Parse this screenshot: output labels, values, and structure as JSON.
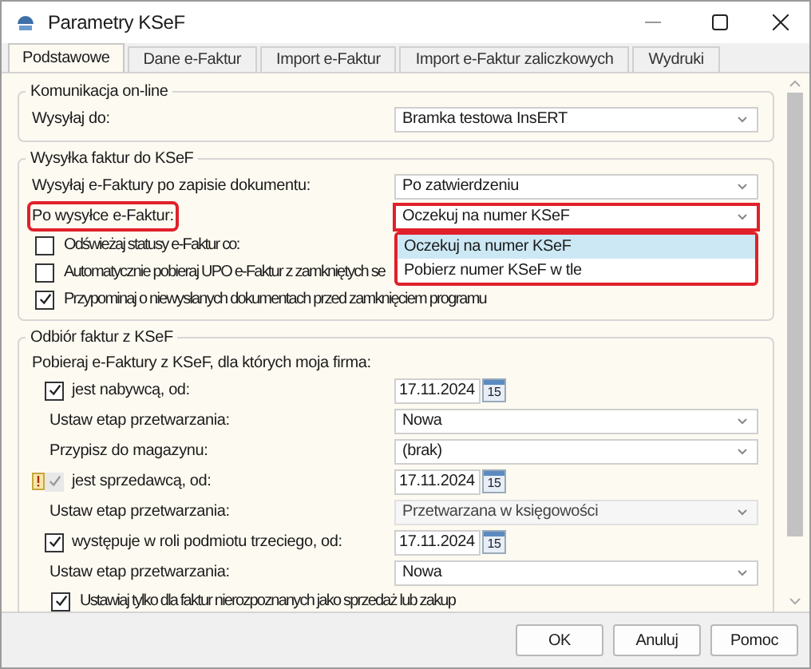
{
  "window": {
    "title": "Parametry KSeF"
  },
  "tabs": [
    {
      "label": "Podstawowe",
      "selected": true
    },
    {
      "label": "Dane e-Faktur",
      "selected": false
    },
    {
      "label": "Import e-Faktur",
      "selected": false
    },
    {
      "label": "Import e-Faktur zaliczkowych",
      "selected": false
    },
    {
      "label": "Wydruki",
      "selected": false
    }
  ],
  "groups": [
    {
      "title": "Komunikacja on-line",
      "rows": [
        {
          "kind": "combo",
          "label": "Wysyłaj do:",
          "value": "Bramka testowa InsERT",
          "disabled": false,
          "highlighted": false
        }
      ]
    },
    {
      "title": "Wysyłka faktur do KSeF",
      "rows": [
        {
          "kind": "combo",
          "label": "Wysyłaj e-Faktury po zapisie dokumentu:",
          "value": "Po zatwierdzeniu",
          "disabled": false,
          "highlighted": false
        },
        {
          "kind": "combo",
          "label": "Po wysyłce e-Faktur:",
          "value": "Oczekuj na numer KSeF",
          "disabled": false,
          "highlighted": true,
          "dropdown": {
            "highlighted": true,
            "items": [
              {
                "label": "Oczekuj na numer KSeF",
                "selected": true
              },
              {
                "label": "Pobierz numer KSeF w tle",
                "selected": false
              }
            ]
          }
        },
        {
          "kind": "checkbox",
          "label": "Odświeżaj statusy e-Faktur co:",
          "checked": false,
          "disabled": false
        },
        {
          "kind": "checkbox",
          "label": "Automatycznie pobieraj UPO e-Faktur z zamkniętych se",
          "checked": false,
          "disabled": false
        },
        {
          "kind": "checkbox",
          "label": "Przypominaj o niewysłanych dokumentach przed zamknięciem programu",
          "checked": true,
          "disabled": false
        }
      ]
    },
    {
      "title": "Odbiór faktur z KSeF",
      "rows": [
        {
          "kind": "text",
          "label": "Pobieraj e-Faktury z KSeF, dla których moja firma:"
        },
        {
          "kind": "date",
          "label": "jest nabywcą, od:",
          "checked": true,
          "disabled": false,
          "warning": false,
          "value": "17.11.2024",
          "day": "15",
          "children": [
            {
              "kind": "combo",
              "label": "Ustaw etap przetwarzania:",
              "value": "Nowa",
              "disabled": false,
              "highlighted": false
            },
            {
              "kind": "combo",
              "label": "Przypisz do magazynu:",
              "value": "(brak)",
              "disabled": false,
              "highlighted": false
            }
          ]
        },
        {
          "kind": "date",
          "label": "jest sprzedawcą, od:",
          "checked": true,
          "disabled": true,
          "warning": true,
          "value": "17.11.2024",
          "day": "15",
          "children": [
            {
              "kind": "combo",
              "label": "Ustaw etap przetwarzania:",
              "value": "Przetwarzana w księgowości",
              "disabled": true,
              "highlighted": false
            }
          ]
        },
        {
          "kind": "date",
          "label": "występuje w roli podmiotu trzeciego, od:",
          "checked": true,
          "disabled": false,
          "warning": false,
          "value": "17.11.2024",
          "day": "15",
          "children": [
            {
              "kind": "combo",
              "label": "Ustaw etap przetwarzania:",
              "value": "Nowa",
              "disabled": false,
              "highlighted": false
            },
            {
              "kind": "checkbox",
              "label": "Ustawiaj tylko dla faktur nierozpoznanych jako sprzedaż lub zakup",
              "checked": true,
              "disabled": false
            }
          ]
        }
      ]
    }
  ],
  "buttons": [
    "OK",
    "Anuluj",
    "Pomoc"
  ]
}
